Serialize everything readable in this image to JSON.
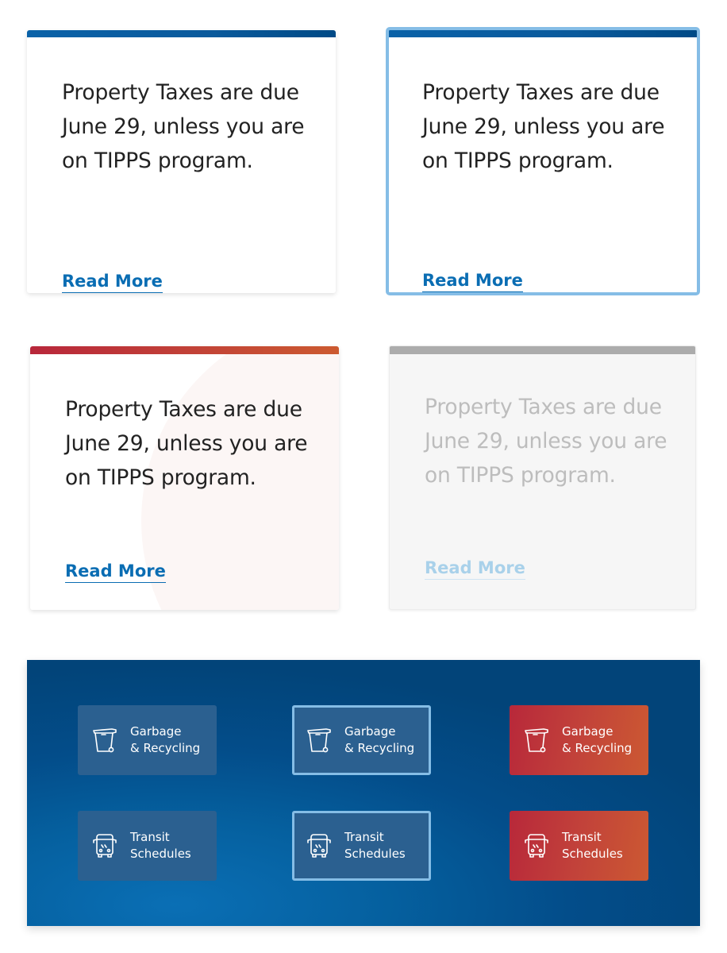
{
  "cards": [
    {
      "state": "default",
      "text": "Property Taxes are due June 29, unless you are on TIPPS program.",
      "link_label": "Read More",
      "accent_color": "#0a5a9c"
    },
    {
      "state": "focus",
      "text": "Property Taxes are due June 29, unless you are on TIPPS program.",
      "link_label": "Read More",
      "accent_color": "#0a5a9c",
      "focus_ring_color": "#85bde6"
    },
    {
      "state": "hover",
      "text": "Property Taxes are due June 29, unless you are on TIPPS program.",
      "link_label": "Read More",
      "accent_color": "#c24337"
    },
    {
      "state": "disabled",
      "text": "Property Taxes are due June 29, unless you are on TIPPS program.",
      "link_label": "Read More",
      "accent_color": "#acacac"
    }
  ],
  "quick_links": {
    "background_color": "#034d8a",
    "tiles": [
      {
        "state": "default",
        "icon": "garbage-bin-icon",
        "line1": "Garbage",
        "line2": "& Recycling"
      },
      {
        "state": "focus",
        "icon": "garbage-bin-icon",
        "line1": "Garbage",
        "line2": "& Recycling"
      },
      {
        "state": "hover",
        "icon": "garbage-bin-icon",
        "line1": "Garbage",
        "line2": "& Recycling"
      },
      {
        "state": "default",
        "icon": "bus-icon",
        "line1": "Transit",
        "line2": "Schedules"
      },
      {
        "state": "focus",
        "icon": "bus-icon",
        "line1": "Transit",
        "line2": "Schedules"
      },
      {
        "state": "hover",
        "icon": "bus-icon",
        "line1": "Transit",
        "line2": "Schedules"
      }
    ]
  }
}
